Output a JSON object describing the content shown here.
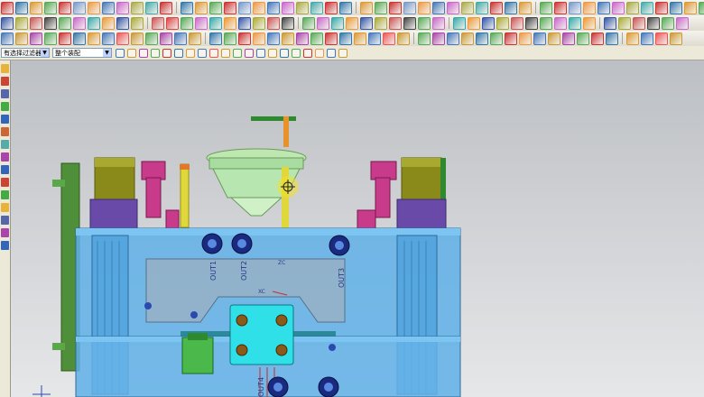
{
  "toolbars": {
    "row1_colors": [
      "#c33",
      "#37a",
      "#d93",
      "#5a5",
      "#c33",
      "#79c",
      "#e94",
      "#47b",
      "#c6c",
      "#aa4",
      "#4aa",
      "#c33",
      "#37a",
      "#d93",
      "#5a5",
      "#c33",
      "#79c",
      "#e94",
      "#47b",
      "#c6c",
      "#aa4",
      "#4aa",
      "#c33",
      "#37a",
      "#d93",
      "#5a5",
      "#c33",
      "#79c",
      "#e94",
      "#47b",
      "#c6c",
      "#aa4",
      "#4aa",
      "#c33",
      "#37a",
      "#d93",
      "#5a5",
      "#c33",
      "#79c",
      "#e94",
      "#47b",
      "#c6c",
      "#aa4",
      "#4aa",
      "#c33",
      "#37a",
      "#d93",
      "#5a5"
    ],
    "row2_colors": [
      "#35a",
      "#aa3",
      "#c55",
      "#444",
      "#5a5",
      "#c6c",
      "#3aa",
      "#e93",
      "#35a",
      "#aa3",
      "#c55",
      "#d44",
      "#5a5",
      "#c6c",
      "#3aa",
      "#e93",
      "#35a",
      "#aa3",
      "#c55",
      "#444",
      "#5a5",
      "#c6c",
      "#3aa",
      "#e93",
      "#35a",
      "#aa3",
      "#c55",
      "#444",
      "#5a5",
      "#c6c",
      "#3aa",
      "#e93",
      "#35a",
      "#aa3",
      "#c55",
      "#444",
      "#5a5",
      "#c6c",
      "#3aa",
      "#e93",
      "#35a",
      "#aa3",
      "#c55",
      "#444",
      "#5a5",
      "#c6c"
    ],
    "row3_colors": [
      "#47b",
      "#c93",
      "#a4a",
      "#5a5",
      "#c33",
      "#37a",
      "#d93",
      "#47b",
      "#e55",
      "#c93",
      "#5a5",
      "#a4a",
      "#47b",
      "#c93",
      "#37a",
      "#5a5",
      "#c33",
      "#e94",
      "#47b",
      "#c93",
      "#a4a",
      "#5a5",
      "#c33",
      "#37a",
      "#d93",
      "#47b",
      "#e55",
      "#c93",
      "#5a5",
      "#a4a",
      "#47b",
      "#c93",
      "#37a",
      "#5a5",
      "#c33",
      "#e94",
      "#47b",
      "#c93",
      "#a4a",
      "#5a5",
      "#c33",
      "#37a",
      "#d93",
      "#47b",
      "#e55",
      "#c93"
    ]
  },
  "selection_bar": {
    "filter_value": "有选择过滤器",
    "scope_value": "整个装配"
  },
  "viewport": {
    "labels": {
      "out1": "OUT1",
      "out2": "OUT2",
      "out3": "OUT3",
      "out4": "OUT4",
      "axis_zc": "ZC",
      "axis_xc": "XC"
    }
  },
  "leftbar_colors": [
    "#e9b23a",
    "#c43",
    "#56a",
    "#4a4",
    "#36b",
    "#c63",
    "#5aa",
    "#a4a",
    "#36b",
    "#c43",
    "#4a4",
    "#e9b23a",
    "#56a",
    "#a4a",
    "#36b"
  ],
  "colors": {
    "plate_blue": "#5fb0e8",
    "green_rail": "#4f8f3a",
    "olive_pillar": "#8a8a1a",
    "magenta_pin": "#c83a8a",
    "cyan_block": "#2fe0e8",
    "bolt_blue": "#2a3aa0"
  }
}
